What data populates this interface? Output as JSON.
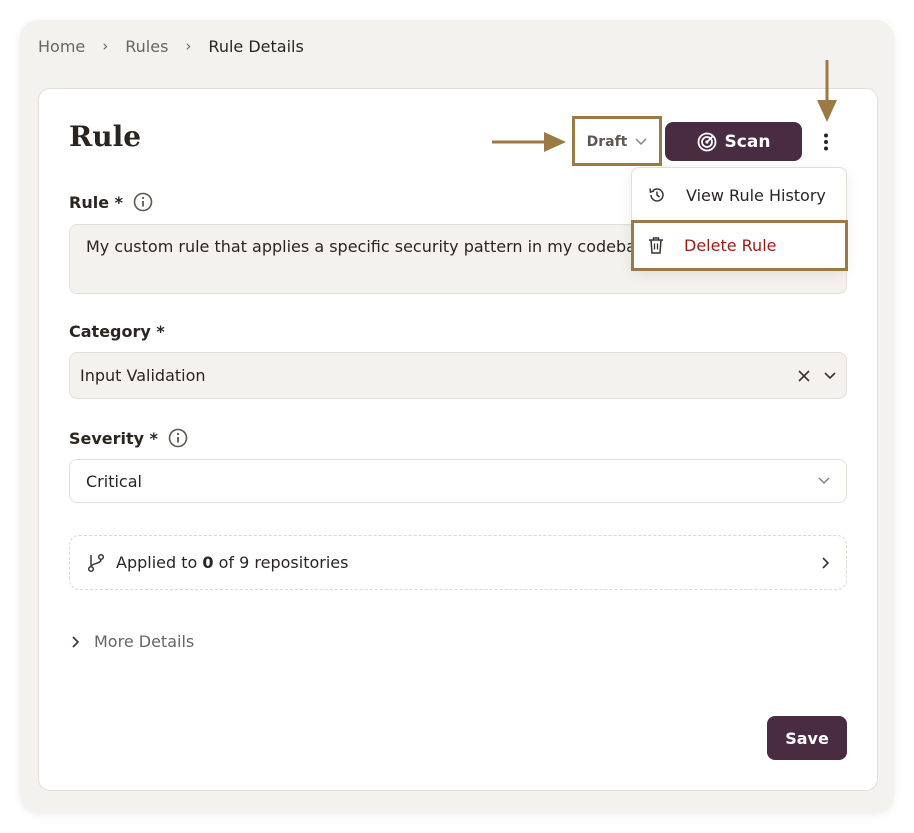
{
  "breadcrumb": {
    "home": "Home",
    "rules": "Rules",
    "current": "Rule Details"
  },
  "header": {
    "title": "Rule",
    "status": "Draft",
    "scan_label": "Scan"
  },
  "menu": {
    "history_label": "View Rule History",
    "delete_label": "Delete Rule"
  },
  "form": {
    "rule_label": "Rule *",
    "rule_value": "My custom rule that applies a specific security pattern in my codebase",
    "category_label": "Category *",
    "category_value": "Input Validation",
    "severity_label": "Severity *",
    "severity_value": "Critical"
  },
  "repos": {
    "prefix": "Applied to ",
    "count": "0",
    "suffix": " of 9 repositories"
  },
  "more_details_label": "More Details",
  "save_label": "Save",
  "colors": {
    "accent": "#4a2c42",
    "annotation": "#9b7a45",
    "danger": "#9b1c14",
    "panel": "#f4f2ee"
  },
  "icons": [
    "chevron-right-icon",
    "chevron-down-icon",
    "radar-icon",
    "kebab-icon",
    "info-icon",
    "history-icon",
    "trash-icon",
    "clear-icon",
    "branch-icon",
    "arrow-annotation-icon"
  ]
}
